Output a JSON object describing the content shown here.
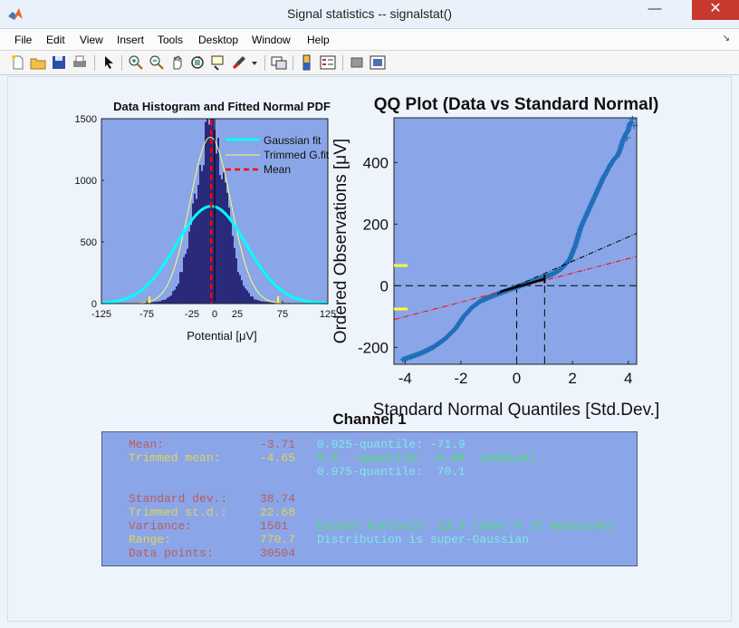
{
  "window": {
    "title": "Signal statistics -- signalstat()",
    "minimize": "—",
    "maximize": "□",
    "close": "✕"
  },
  "menu": {
    "items": [
      "File",
      "Edit",
      "View",
      "Insert",
      "Tools",
      "Desktop",
      "Window",
      "Help"
    ],
    "overflow": "↘"
  },
  "toolbar": {
    "icons": [
      "new-figure-icon",
      "open-file-icon",
      "save-icon",
      "print-icon",
      "pointer-icon",
      "zoom-in-icon",
      "zoom-out-icon",
      "pan-icon",
      "rotate-icon",
      "data-cursor-icon",
      "brush-icon",
      "brush-dropdown-icon",
      "link-plot-icon",
      "colorbar-icon",
      "legend-icon",
      "hide-plot-tools-icon",
      "show-plot-tools-icon"
    ]
  },
  "histogram": {
    "title": "Data Histogram and Fitted Normal PDF",
    "xlabel": "Potential [μV]",
    "xticks": [
      "-125",
      "-75",
      "-25",
      "0",
      "25",
      "75",
      "125"
    ],
    "yticks": [
      "0",
      "500",
      "1000",
      "1500"
    ],
    "legend": [
      "Gaussian fit",
      "Trimmed G.fit",
      "Mean"
    ]
  },
  "qq": {
    "title": "QQ Plot (Data vs Standard Normal)",
    "xlabel": "Standard Normal Quantiles [Std.Dev.]",
    "ylabel": "Ordered Observations [μV]",
    "xticks": [
      "-4",
      "-2",
      "0",
      "2",
      "4"
    ],
    "yticks": [
      "-200",
      "0",
      "200",
      "400"
    ]
  },
  "chart_data": [
    {
      "type": "bar",
      "title": "Data Histogram and Fitted Normal PDF",
      "xlabel": "Potential [μV]",
      "ylabel": "",
      "xlim": [
        -125,
        125
      ],
      "ylim": [
        0,
        1500
      ],
      "series": [
        {
          "name": "Gaussian fit",
          "mean": -3.71,
          "std": 38.74,
          "peak": 790
        },
        {
          "name": "Trimmed G.fit",
          "mean": -4.65,
          "std": 22.68,
          "peak": 1350
        },
        {
          "name": "Mean",
          "x": -3.71
        }
      ],
      "legend": "top-right",
      "colors": {
        "bars": "#2a2a7c",
        "background": "#8aa6e8",
        "gaussian": "#00ffff",
        "trimmed": "#ffff66",
        "mean": "#ff0000"
      }
    },
    {
      "type": "scatter",
      "title": "QQ Plot (Data vs Standard Normal)",
      "xlabel": "Standard Normal Quantiles [Std.Dev.]",
      "ylabel": "Ordered Observations [μV]",
      "xlim": [
        -4.4,
        4.3
      ],
      "ylim": [
        -255,
        545
      ],
      "series": [
        {
          "name": "",
          "points": [
            [
              -4.1,
              -240
            ],
            [
              -3.8,
              -231
            ],
            [
              -3.4,
              -218
            ],
            [
              -3.0,
              -200
            ],
            [
              -2.6,
              -175
            ],
            [
              -2.2,
              -140
            ],
            [
              -1.9,
              -100
            ],
            [
              -1.6,
              -70
            ],
            [
              -1.3,
              -50
            ],
            [
              -1.0,
              -38
            ],
            [
              -0.6,
              -24
            ],
            [
              -0.3,
              -14
            ],
            [
              0,
              -4
            ],
            [
              0.3,
              5
            ],
            [
              0.6,
              15
            ],
            [
              1.0,
              28
            ],
            [
              1.3,
              38
            ],
            [
              1.6,
              55
            ],
            [
              1.9,
              85
            ],
            [
              2.1,
              130
            ],
            [
              2.3,
              190
            ],
            [
              2.5,
              230
            ],
            [
              2.7,
              270
            ],
            [
              2.9,
              310
            ],
            [
              3.0,
              330
            ],
            [
              3.1,
              350
            ],
            [
              3.2,
              365
            ],
            [
              3.3,
              383
            ],
            [
              3.4,
              398
            ],
            [
              3.5,
              412
            ],
            [
              3.6,
              420
            ],
            [
              3.7,
              440
            ],
            [
              3.75,
              455
            ],
            [
              3.8,
              470
            ],
            [
              3.9,
              490
            ],
            [
              4.0,
              505
            ],
            [
              4.05,
              525
            ],
            [
              4.1,
              530
            ]
          ]
        }
      ],
      "reference_lines": [
        {
          "color": "#ff0000",
          "style": "dashdot",
          "points": [
            [
              -4.4,
              -110
            ],
            [
              4.3,
              95
            ]
          ]
        },
        {
          "color": "#000000",
          "style": "dashdot",
          "points": [
            [
              -0.7,
              -27
            ],
            [
              4.3,
              170
            ]
          ]
        }
      ],
      "markers": {
        "x": [
          0,
          1
        ],
        "y": 0
      }
    }
  ],
  "stats": {
    "channel_title": "Channel 1",
    "rows": [
      {
        "label": "Mean:",
        "value": "-3.71",
        "color": "red"
      },
      {
        "label": "Trimmed mean:",
        "value": "-4.65",
        "color": "yellow"
      },
      {
        "label": "Standard dev.:",
        "value": "38.74",
        "color": "red"
      },
      {
        "label": "Trimmed st.d.:",
        "value": "22.68",
        "color": "yellow"
      },
      {
        "label": "Variance:",
        "value": "1501",
        "color": "red"
      },
      {
        "label": "Range:",
        "value": "770.7",
        "color": "yellow"
      },
      {
        "label": "Data points:",
        "value": "30504",
        "color": "red"
      }
    ],
    "quantile_lower": "0.025-quantile: -71.9",
    "quantile_median": "0.5  -quantile: -4.86  (median)",
    "quantile_upper": "0.975-quantile:  70.1",
    "kurtosis": "Excess kurtosis: 13.3 (near 0 if Gaussian)",
    "distribution": "Distribution is super-Gaussian"
  }
}
